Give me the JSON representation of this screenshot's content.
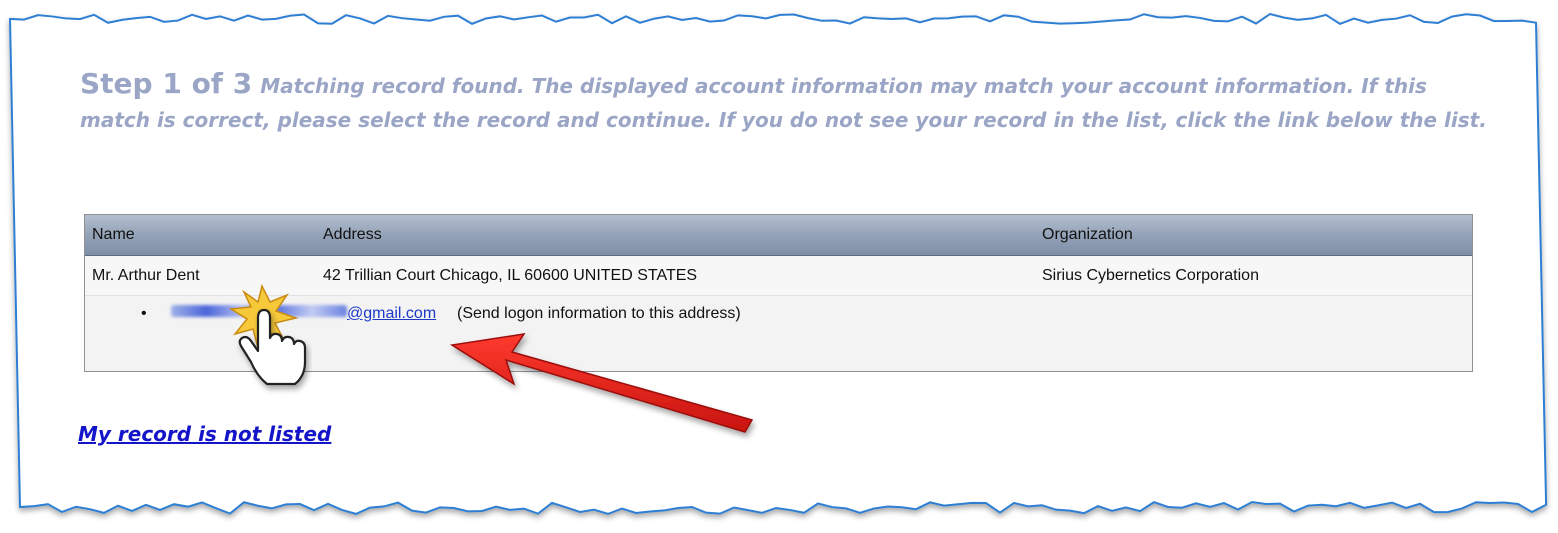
{
  "step": {
    "number_label": "Step 1 of 3",
    "message": "Matching record found.  The displayed account information may match your account information. If this match is correct, please select the record and continue. If you do not see your record in the list, click the link below the list."
  },
  "table": {
    "columns": [
      "Name",
      "Address",
      "Organization"
    ],
    "rows": [
      {
        "name": "Mr. Arthur Dent",
        "address": "42 Trillian Court Chicago, IL 60600 UNITED STATES",
        "organization": "Sirius Cybernetics Corporation"
      }
    ],
    "email": {
      "bullet": "•",
      "domain": "@gmail.com",
      "note": "(Send logon information to this address)"
    }
  },
  "links": {
    "not_listed": "My record is not listed"
  },
  "icons": {
    "cursor": "hand-pointer-icon",
    "arrow": "red-arrow-annotation"
  },
  "colors": {
    "heading": "#9ba6c6",
    "link": "#1414c8",
    "arrow": "#e0201a",
    "frame": "#3a85d6"
  }
}
